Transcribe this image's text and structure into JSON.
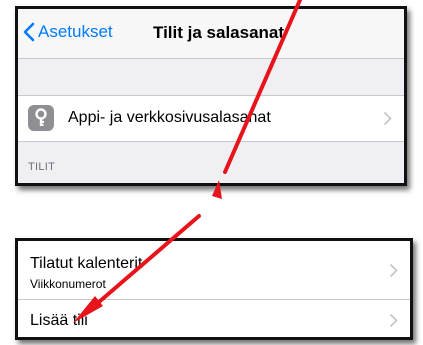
{
  "nav": {
    "back_label": "Asetukset",
    "title": "Tilit ja salasanat"
  },
  "passwords_row": {
    "icon": "key-icon",
    "label": "Appi- ja verkkosivusalasanat"
  },
  "accounts_section": {
    "header": "TILIT"
  },
  "accounts": [
    {
      "label": "Tilatut kalenterit",
      "sublabel": "Viikkonumerot"
    },
    {
      "label": "Lisää tili"
    }
  ],
  "colors": {
    "accent": "#007aff",
    "annotation_arrow": "#e8141b",
    "grouped_background": "#efeff4",
    "separator": "#c8c7cc"
  }
}
